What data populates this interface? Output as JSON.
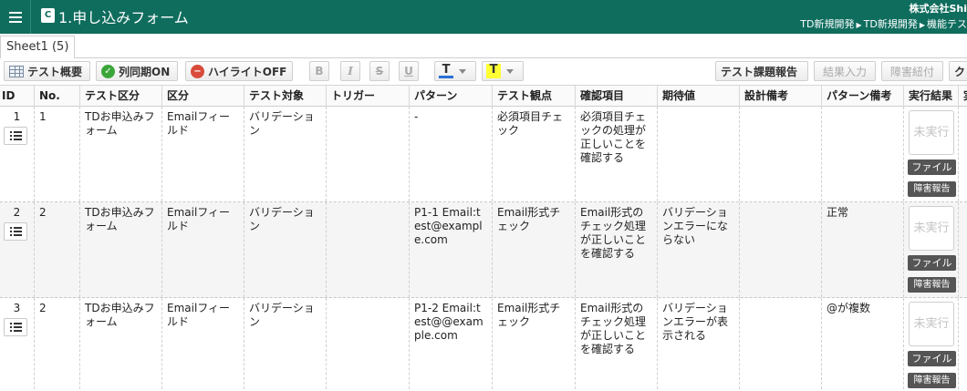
{
  "header": {
    "title": "1.申し込みフォーム",
    "sheet_icon_text": "C",
    "company": "株式会社Shi",
    "breadcrumb": [
      "TD新規開発",
      "TD新規開発",
      "機能テス"
    ]
  },
  "tabs": [
    {
      "label": "Sheet1 (5)"
    }
  ],
  "toolbar": {
    "test_overview": "テスト概要",
    "column_sync": "列同期ON",
    "highlight": "ハイライトOFF",
    "bold": "B",
    "italic": "I",
    "strike": "S",
    "underline": "U",
    "font_color_glyph": "T",
    "bg_color_glyph": "T",
    "test_issue_report": "テスト課題報告",
    "result_input": "結果入力",
    "defect_link": "障害紐付",
    "more": "ク"
  },
  "colors": {
    "header_bg": "#0f6d5e",
    "font_color_bar": "#2b6fd6",
    "bg_color_fill": "#ffff33"
  },
  "columns": [
    "ID",
    "No.",
    "テスト区分",
    "区分",
    "テスト対象",
    "トリガー",
    "パターン",
    "テスト観点",
    "確認項目",
    "期待値",
    "設計備考",
    "パターン備考",
    "実行結果",
    "実"
  ],
  "rows": [
    {
      "id": "1",
      "no": "1",
      "test_category": "TDお申込みフォーム",
      "category": "Emailフィールド",
      "target": "バリデーション",
      "trigger": "",
      "pattern": "-",
      "viewpoint": "必須項目チェック",
      "check_item": "必須項目チェックの処理が正しいことを確認する",
      "expected": "",
      "design_note": "",
      "pattern_note": "",
      "exec_status": "未実行",
      "file_label": "ファイル",
      "bug_label": "障害報告"
    },
    {
      "id": "2",
      "no": "2",
      "test_category": "TDお申込みフォーム",
      "category": "Emailフィールド",
      "target": "バリデーション",
      "trigger": "",
      "pattern": "P1-1 Email:test@example.com",
      "viewpoint": "Email形式チェック",
      "check_item": "Email形式のチェック処理が正しいことを確認する",
      "expected": "バリデーションエラーにならない",
      "design_note": "",
      "pattern_note": "正常",
      "exec_status": "未実行",
      "file_label": "ファイル",
      "bug_label": "障害報告"
    },
    {
      "id": "3",
      "no": "2",
      "test_category": "TDお申込みフォーム",
      "category": "Emailフィールド",
      "target": "バリデーション",
      "trigger": "",
      "pattern": "P1-2 Email:test@@example.com",
      "viewpoint": "Email形式チェック",
      "check_item": "Email形式のチェック処理が正しいことを確認する",
      "expected": "バリデーションエラーが表示される",
      "design_note": "",
      "pattern_note": "@が複数",
      "exec_status": "未実行",
      "file_label": "ファイル",
      "bug_label": "障害報告"
    }
  ]
}
